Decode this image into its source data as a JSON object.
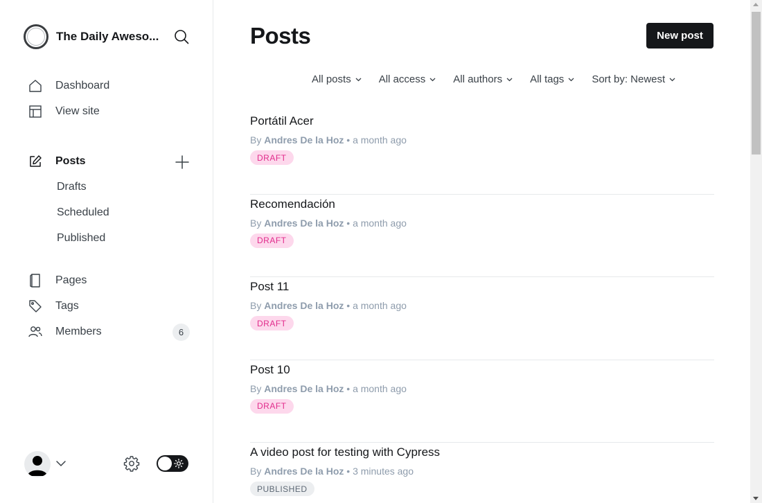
{
  "site": {
    "title": "The Daily Aweso..."
  },
  "nav": {
    "dashboard": "Dashboard",
    "view_site": "View site",
    "posts": "Posts",
    "drafts": "Drafts",
    "scheduled": "Scheduled",
    "published": "Published",
    "pages": "Pages",
    "tags": "Tags",
    "members": "Members",
    "members_count": "6"
  },
  "header": {
    "title": "Posts",
    "new_post_label": "New post"
  },
  "filters": [
    {
      "label": "All posts"
    },
    {
      "label": "All access"
    },
    {
      "label": "All authors"
    },
    {
      "label": "All tags"
    },
    {
      "label": "Sort by: Newest"
    }
  ],
  "posts": [
    {
      "title": "Portátil Acer",
      "by": "By",
      "author": "Andres De la Hoz",
      "sep": "•",
      "time": "a month ago",
      "status": "DRAFT"
    },
    {
      "title": "Recomendación",
      "by": "By",
      "author": "Andres De la Hoz",
      "sep": "•",
      "time": "a month ago",
      "status": "DRAFT"
    },
    {
      "title": "Post 11",
      "by": "By",
      "author": "Andres De la Hoz",
      "sep": "•",
      "time": "a month ago",
      "status": "DRAFT"
    },
    {
      "title": "Post 10",
      "by": "By",
      "author": "Andres De la Hoz",
      "sep": "•",
      "time": "a month ago",
      "status": "DRAFT"
    },
    {
      "title": "A video post for testing with Cypress",
      "by": "By",
      "author": "Andres De la Hoz",
      "sep": "•",
      "time": "3 minutes ago",
      "status": "PUBLISHED"
    }
  ],
  "colors": {
    "accent": "#15171a",
    "draft_bg": "#fdd8ec",
    "draft_text": "#e12b8b",
    "published_bg": "#eceef0",
    "published_text": "#5e6975"
  }
}
